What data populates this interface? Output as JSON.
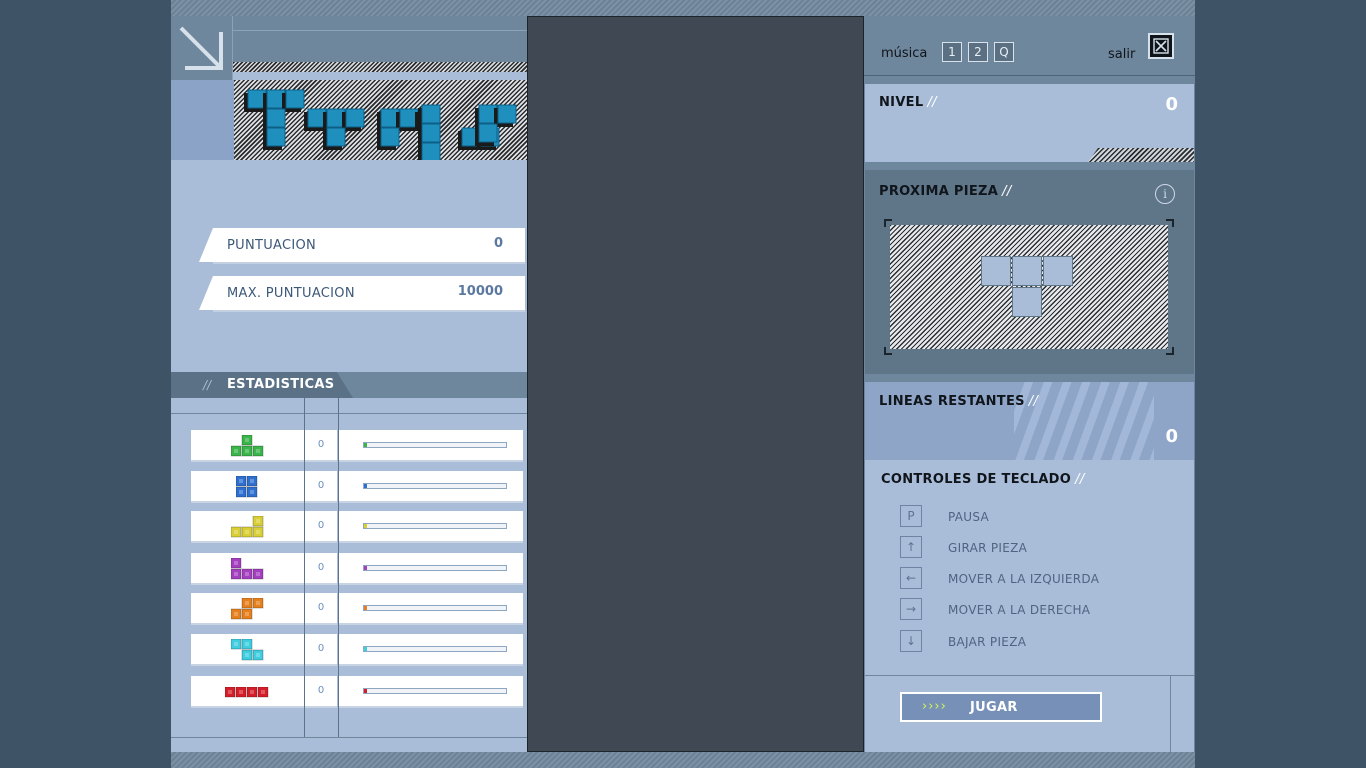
{
  "score": {
    "label": "PUNTUACION",
    "value": "0"
  },
  "max_score": {
    "label": "MAX. PUNTUACION",
    "value": "10000"
  },
  "stats": {
    "title": "ESTADISTICAS",
    "slashes": "//",
    "rows": [
      {
        "piece": "T-green",
        "count": "0",
        "color": "#3ab54a"
      },
      {
        "piece": "O-blue",
        "count": "0",
        "color": "#2e6fd0"
      },
      {
        "piece": "L-yellow",
        "count": "0",
        "color": "#d9cf35"
      },
      {
        "piece": "J-purple",
        "count": "0",
        "color": "#a43fc0"
      },
      {
        "piece": "S-orange",
        "count": "0",
        "color": "#e6801e"
      },
      {
        "piece": "Z-cyan",
        "count": "0",
        "color": "#3fcde0"
      },
      {
        "piece": "I-red",
        "count": "0",
        "color": "#d41f2a"
      }
    ]
  },
  "topbar": {
    "music_label": "música",
    "music_buttons": [
      "1",
      "2",
      "Q"
    ],
    "exit_label": "salir"
  },
  "level": {
    "label": "NIVEL",
    "slashes": "//",
    "value": "0"
  },
  "next_piece": {
    "label": "PROXIMA PIEZA",
    "slashes": "//",
    "info_icon": "i",
    "piece": "T"
  },
  "lines_remaining": {
    "label": "LINEAS RESTANTES",
    "slashes": "//",
    "value": "0"
  },
  "controls": {
    "label": "CONTROLES DE TECLADO",
    "slashes": "//",
    "items": [
      {
        "key": "P",
        "action": "PAUSA"
      },
      {
        "key": "↑",
        "action": "GIRAR PIEZA"
      },
      {
        "key": "←",
        "action": "MOVER A LA IZQUIERDA"
      },
      {
        "key": "→",
        "action": "MOVER A LA DERECHA"
      },
      {
        "key": "↓",
        "action": "BAJAR PIEZA"
      }
    ]
  },
  "play_button": {
    "arrows": "››››",
    "label": "JUGAR"
  },
  "colors": {
    "panel": "#a9bdd8",
    "frame": "#6f879c",
    "board": "#3f4853",
    "logo_blocks": "#1f8fbe"
  }
}
